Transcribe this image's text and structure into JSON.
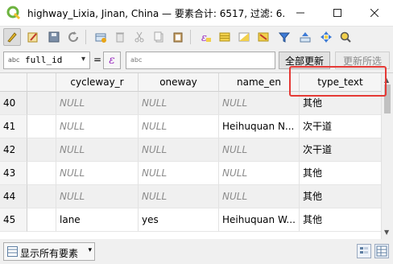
{
  "window": {
    "title": "highway_Lixia, Jinan, China — 要素合计: 6517, 过滤: 6..."
  },
  "toolbar": {
    "buttons": [
      {
        "icon": "pencil-edit-icon",
        "active": true
      },
      {
        "icon": "multi-edit-icon",
        "active": false
      },
      {
        "icon": "save-icon",
        "active": false
      },
      {
        "icon": "reload-icon",
        "active": false
      },
      {
        "icon": "add-feature-icon",
        "active": false
      },
      {
        "icon": "delete-feature-icon",
        "active": false
      },
      {
        "icon": "cut-icon",
        "active": false
      },
      {
        "icon": "copy-icon",
        "active": false
      },
      {
        "icon": "paste-icon",
        "active": false
      },
      {
        "icon": "select-by-expression-icon",
        "active": false
      },
      {
        "icon": "select-all-icon",
        "active": false
      },
      {
        "icon": "invert-selection-icon",
        "active": false
      },
      {
        "icon": "deselect-icon",
        "active": false
      },
      {
        "icon": "filter-icon",
        "active": false
      },
      {
        "icon": "move-selection-top-icon",
        "active": false
      },
      {
        "icon": "pan-to-selection-icon",
        "active": false
      },
      {
        "icon": "zoom-to-selection-icon",
        "active": false
      }
    ]
  },
  "expression": {
    "field_prefix": "abc",
    "field_value": "full_id",
    "equals": "=",
    "expr_symbol": "ε",
    "value_prefix": "abc",
    "update_all_label": "全部更新",
    "update_selected_label": "更新所选"
  },
  "table": {
    "columns": [
      "",
      "",
      "cycleway_r",
      "oneway",
      "name_en",
      "type_text"
    ],
    "rows": [
      {
        "num": "40",
        "cycleway_r": "NULL",
        "oneway": "NULL",
        "name_en": "NULL",
        "type_text": "其他"
      },
      {
        "num": "41",
        "cycleway_r": "NULL",
        "oneway": "NULL",
        "name_en": "Heihuquan N...",
        "type_text": "次干道"
      },
      {
        "num": "42",
        "cycleway_r": "NULL",
        "oneway": "NULL",
        "name_en": "NULL",
        "type_text": "次干道"
      },
      {
        "num": "43",
        "cycleway_r": "NULL",
        "oneway": "NULL",
        "name_en": "NULL",
        "type_text": "其他"
      },
      {
        "num": "44",
        "cycleway_r": "NULL",
        "oneway": "NULL",
        "name_en": "NULL",
        "type_text": "其他"
      },
      {
        "num": "45",
        "cycleway_r": "lane",
        "oneway": "yes",
        "name_en": "Heihuquan W...",
        "type_text": "其他"
      }
    ]
  },
  "footer": {
    "filter_label": "显示所有要素"
  },
  "colors": {
    "highlight": "#e53935",
    "null_text": "#8c8c8c"
  }
}
